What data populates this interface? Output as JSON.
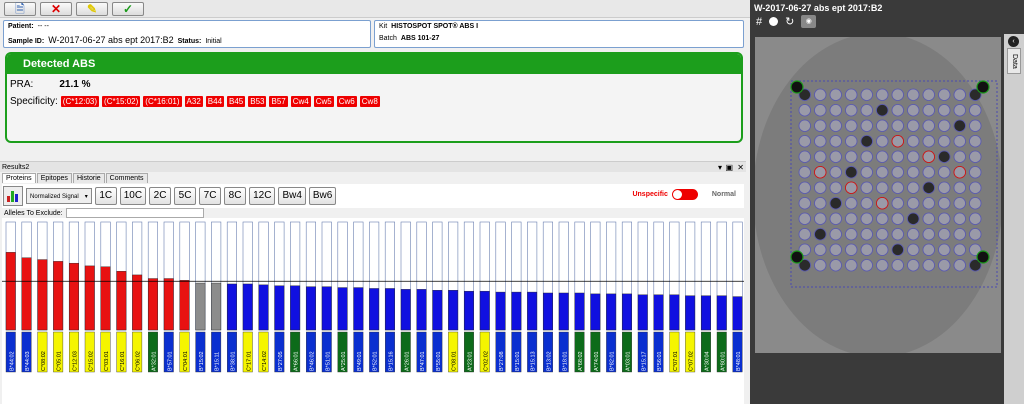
{
  "toolbar": {
    "buttons": [
      {
        "name": "doc-button",
        "icon": "document-icon",
        "glyph": "🗎"
      },
      {
        "name": "cancel-button",
        "icon": "cross-icon",
        "glyph": "✕"
      },
      {
        "name": "edit-button",
        "icon": "pencil-icon",
        "glyph": "✎"
      },
      {
        "name": "confirm-button",
        "icon": "check-icon",
        "glyph": "✓"
      }
    ]
  },
  "patient": {
    "patient_label": "Patient:",
    "patient_value": "-- --",
    "sample_label": "Sample ID:",
    "sample_value": "W-2017-06-27 abs ept 2017:B2",
    "status_label": "Status:",
    "status_value": "Initial"
  },
  "kit": {
    "kit_label": "Kit",
    "kit_value": "HISTOSPOT SPOT® ABS I",
    "batch_label": "Batch",
    "batch_value": "ABS 101-27"
  },
  "abs": {
    "title": "Detected ABS",
    "pra_label": "PRA:",
    "pra_value": "21.1 %",
    "spec_label": "Specificity:",
    "specificities": [
      "(C*12:03)",
      "(C*15:02)",
      "(C*16:01)",
      "A32",
      "B44",
      "B45",
      "B53",
      "B57",
      "Cw4",
      "Cw5",
      "Cw6",
      "Cw8"
    ]
  },
  "results": {
    "title": "Results2",
    "controls": [
      "▾",
      "▣",
      "✕"
    ],
    "tabs": [
      "Proteins",
      "Epitopes",
      "Historie",
      "Comments"
    ],
    "signal_select": "Normalized Signal",
    "chips": [
      "1C",
      "10C",
      "2C",
      "5C",
      "7C",
      "8C",
      "12C",
      "Bw4",
      "Bw6"
    ],
    "unspecific_label": "Unspecific",
    "normal_label": "Normal",
    "alleles_label": "Alleles To Exclude:"
  },
  "chart_data": {
    "type": "bar",
    "title": "",
    "xlabel": "",
    "ylabel": "",
    "ylim": [
      0,
      1
    ],
    "colors": {
      "positive": "#e81212",
      "borderline": "#8c8c8c",
      "negative": "#1010e0"
    },
    "label_colors": {
      "B": "#0a2fd0",
      "C": "#f5f500",
      "A": "#0d6b1a"
    },
    "categories": [
      "B*44:02",
      "B*44:03",
      "C*08:02",
      "C*05:01",
      "C*12:03",
      "C*15:02",
      "C*03:01",
      "C*16:01",
      "C*06:02",
      "A*32:01",
      "B*57:01",
      "C*04:01",
      "B*15:02",
      "B*15:11",
      "B*38:01",
      "C*17:01",
      "C*14:02",
      "B*27:05",
      "A*66:01",
      "B*46:02",
      "B*51:01",
      "A*25:01",
      "B*49:01",
      "B*52:01",
      "B*15:16",
      "A*26:01",
      "B*47:01",
      "B*55:01",
      "C*08:01",
      "A*23:01",
      "C*02:02",
      "B*27:08",
      "B*15:01",
      "B*15:13",
      "B*13:02",
      "B*18:01",
      "A*68:02",
      "A*74:01",
      "B*82:01",
      "A*03:01",
      "B*15:17",
      "B*56:01",
      "C*07:01",
      "C*07:02",
      "A*30:04",
      "A*80:01",
      "B*48:01"
    ],
    "values": [
      0.86,
      0.8,
      0.78,
      0.76,
      0.74,
      0.71,
      0.7,
      0.65,
      0.61,
      0.57,
      0.57,
      0.55,
      0.52,
      0.52,
      0.51,
      0.51,
      0.5,
      0.49,
      0.49,
      0.48,
      0.48,
      0.47,
      0.47,
      0.46,
      0.46,
      0.45,
      0.45,
      0.44,
      0.44,
      0.43,
      0.43,
      0.42,
      0.42,
      0.42,
      0.41,
      0.41,
      0.41,
      0.4,
      0.4,
      0.4,
      0.39,
      0.39,
      0.39,
      0.38,
      0.38,
      0.38,
      0.37
    ],
    "classes": [
      "positive",
      "positive",
      "positive",
      "positive",
      "positive",
      "positive",
      "positive",
      "positive",
      "positive",
      "positive",
      "positive",
      "positive",
      "borderline",
      "borderline",
      "negative",
      "negative",
      "negative",
      "negative",
      "negative",
      "negative",
      "negative",
      "negative",
      "negative",
      "negative",
      "negative",
      "negative",
      "negative",
      "negative",
      "negative",
      "negative",
      "negative",
      "negative",
      "negative",
      "negative",
      "negative",
      "negative",
      "negative",
      "negative",
      "negative",
      "negative",
      "negative",
      "negative",
      "negative",
      "negative",
      "negative",
      "negative",
      "negative"
    ],
    "cutoff": 0.54
  },
  "viewer": {
    "title": "W-2017-06-27 abs ept 2017:B2",
    "side_tab": "Data",
    "tools": [
      "#",
      "↻"
    ]
  }
}
